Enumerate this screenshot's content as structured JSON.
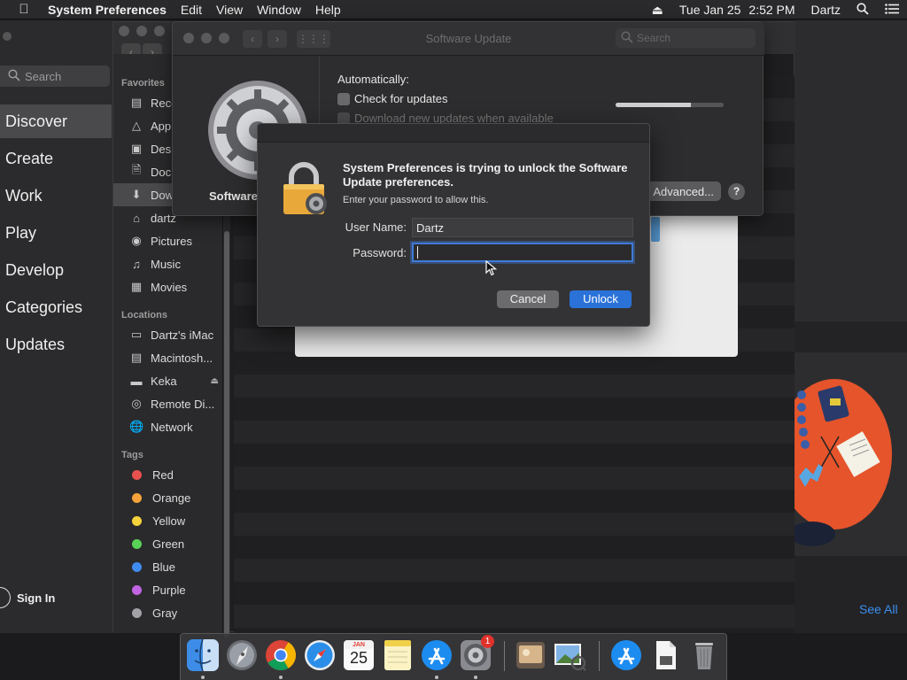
{
  "menubar": {
    "app_name": "System Preferences",
    "menus": [
      "Edit",
      "View",
      "Window",
      "Help"
    ],
    "date": "Tue Jan 25",
    "time": "2:52 PM",
    "user": "Dartz"
  },
  "appstore": {
    "search_placeholder": "Search",
    "nav": [
      "Discover",
      "Create",
      "Work",
      "Play",
      "Develop",
      "Categories",
      "Updates"
    ],
    "active_nav": "Discover",
    "sign_in": "Sign In",
    "see_all": "See All"
  },
  "finder": {
    "favorites_header": "Favorites",
    "favorites": [
      {
        "label": "Rece",
        "icon": "clock-icon"
      },
      {
        "label": "App",
        "icon": "applications-icon"
      },
      {
        "label": "Des",
        "icon": "desktop-icon"
      },
      {
        "label": "Doc",
        "icon": "document-icon"
      },
      {
        "label": "Dow",
        "icon": "download-icon"
      },
      {
        "label": "dartz",
        "icon": "home-icon"
      },
      {
        "label": "Pictures",
        "icon": "camera-icon"
      },
      {
        "label": "Music",
        "icon": "music-icon"
      },
      {
        "label": "Movies",
        "icon": "film-icon"
      }
    ],
    "locations_header": "Locations",
    "locations": [
      {
        "label": "Dartz's iMac",
        "icon": "imac-icon"
      },
      {
        "label": "Macintosh...",
        "icon": "hard-drive-icon"
      },
      {
        "label": "Keka",
        "icon": "disk-icon"
      },
      {
        "label": "Remote Di...",
        "icon": "remote-disc-icon"
      },
      {
        "label": "Network",
        "icon": "network-icon"
      }
    ],
    "tags_header": "Tags",
    "tags": [
      {
        "label": "Red",
        "color": "#e9514e"
      },
      {
        "label": "Orange",
        "color": "#f5a33a"
      },
      {
        "label": "Yellow",
        "color": "#f3d23b"
      },
      {
        "label": "Green",
        "color": "#5ad157"
      },
      {
        "label": "Blue",
        "color": "#3f8cf0"
      },
      {
        "label": "Purple",
        "color": "#c164e2"
      },
      {
        "label": "Gray",
        "color": "#a2a2a6"
      }
    ]
  },
  "software_update": {
    "window_title": "Software Update",
    "search_placeholder": "Search",
    "pane_name": "Software",
    "automatically_label": "Automatically:",
    "check_label": "Check for updates",
    "download_label": "Download new updates when available",
    "progress_fraction": 0.7,
    "advanced_label": "Advanced...",
    "help_label": "?"
  },
  "auth_dialog": {
    "title": "System Preferences is trying to unlock the Software Update preferences.",
    "subtitle": "Enter your password to allow this.",
    "username_label": "User Name:",
    "username_value": "Dartz",
    "password_label": "Password:",
    "password_value": "",
    "cancel_label": "Cancel",
    "unlock_label": "Unlock"
  },
  "dock": {
    "items": [
      "finder-icon",
      "launchpad-icon",
      "chrome-icon",
      "safari-icon",
      "calendar-icon",
      "notes-icon",
      "app-store-icon",
      "system-preferences-icon",
      "preview-icon",
      "image-viewer-icon",
      "app-store-download-icon",
      "document-icon",
      "trash-icon"
    ],
    "calendar_month": "JAN",
    "calendar_day": "25",
    "prefs_badge": "1"
  },
  "colors": {
    "accent": "#2a72d8",
    "link": "#3b8ff0",
    "art_orange": "#e5542b"
  }
}
